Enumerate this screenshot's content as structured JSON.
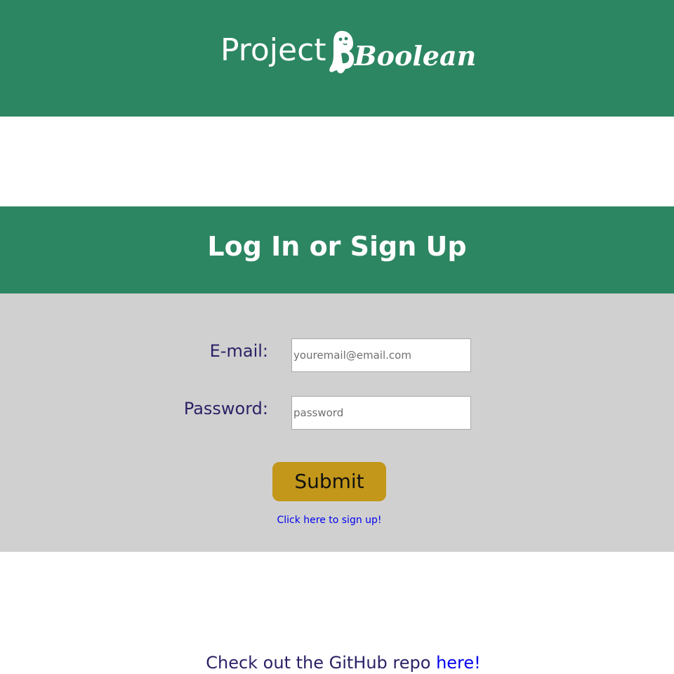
{
  "header": {
    "logo_word_project": "Project",
    "logo_word_boolean": "Boolean",
    "background_color": "#2c8662"
  },
  "section": {
    "title": "Log In or Sign Up",
    "background_color": "#2c8662"
  },
  "form": {
    "email_label": "E-mail:",
    "email_placeholder": "youremail@email.com",
    "email_value": "",
    "password_label": "Password:",
    "password_placeholder": "password",
    "password_value": "",
    "submit_label": "Submit",
    "submit_color": "#c2971a",
    "signup_link_text": "Click here to sign up!",
    "panel_color": "#d0d0d0"
  },
  "footer": {
    "text": "Check out the GitHub repo ",
    "link_text": "here!"
  },
  "icons": {
    "logo_ghost": "ghost-icon"
  }
}
